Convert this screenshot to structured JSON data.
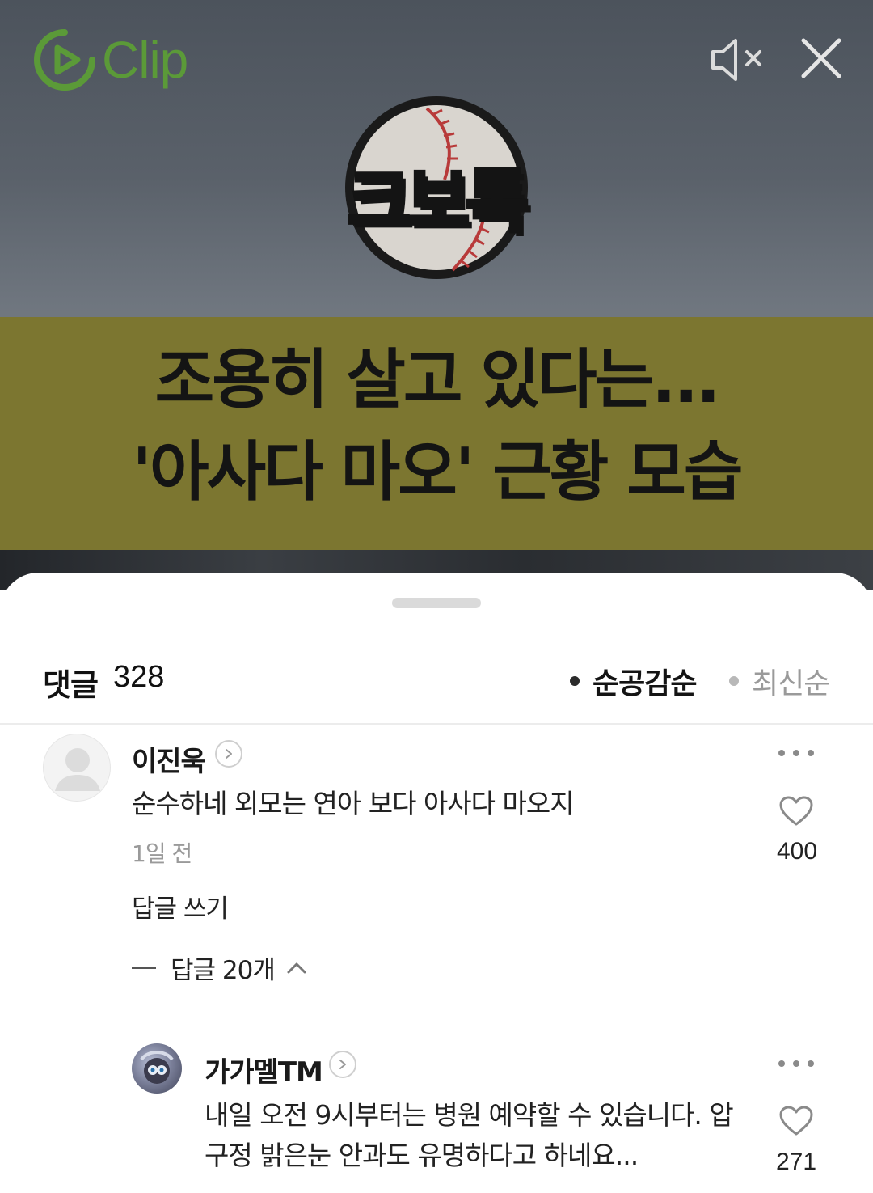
{
  "video": {
    "logo_text": "Clip",
    "channel_badge": "크보톡",
    "headline_line1": "조용히 살고 있다는...",
    "headline_line2": "'아사다 마오' 근황 모습",
    "accent_color": "#5b9a38",
    "banner_color": "#7c7630"
  },
  "comments_header": {
    "title": "댓글",
    "count": "328",
    "sort_options": [
      {
        "label": "순공감순",
        "active": true
      },
      {
        "label": "최신순",
        "active": false
      }
    ]
  },
  "comment": {
    "author": "이진욱",
    "text": "순수하네 외모는 연아 보다 아사다 마오지",
    "time": "1일 전",
    "likes": "400",
    "reply_action": "답글 쓰기",
    "replies_toggle": "답글 20개"
  },
  "reply": {
    "author": "가가멜TM",
    "text_line1": "내일 오전 9시부터는 병원 예약할 수 있습니다. 압",
    "text_line2": "구정 밝은눈 안과도 유명하다고 하네요...",
    "likes": "271"
  }
}
